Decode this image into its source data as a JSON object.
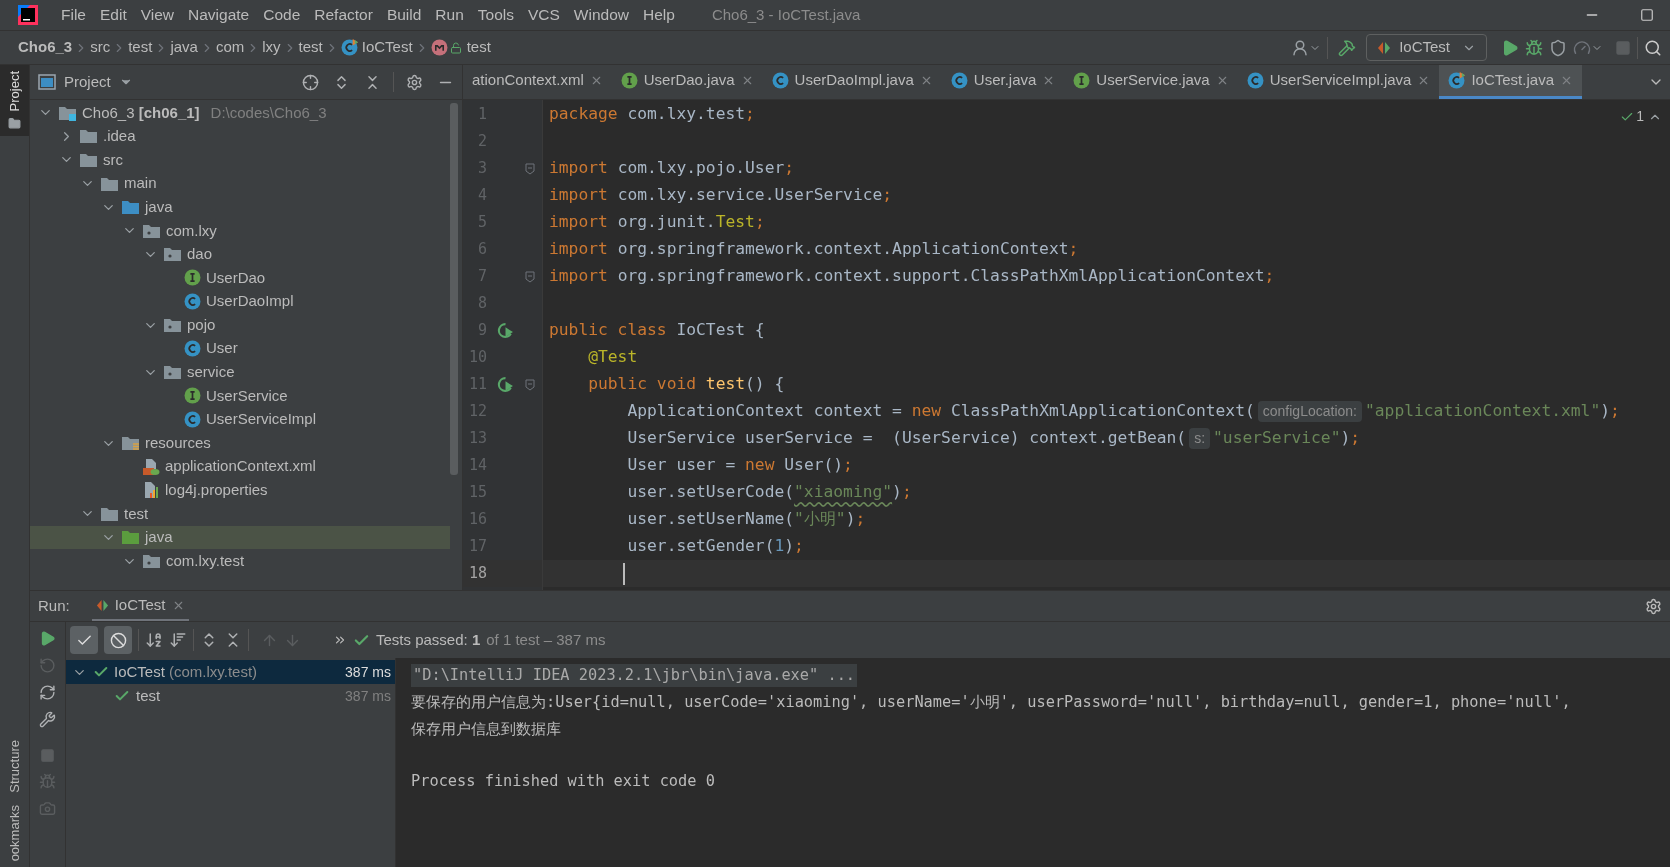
{
  "window": {
    "title": "Cho6_3 - IoCTest.java",
    "menu": [
      "File",
      "Edit",
      "View",
      "Navigate",
      "Code",
      "Refactor",
      "Build",
      "Run",
      "Tools",
      "VCS",
      "Window",
      "Help"
    ]
  },
  "breadcrumb": [
    {
      "label": "Cho6_3",
      "kind": "project"
    },
    {
      "label": "src",
      "kind": "folder"
    },
    {
      "label": "test",
      "kind": "folder"
    },
    {
      "label": "java",
      "kind": "folder"
    },
    {
      "label": "com",
      "kind": "folder"
    },
    {
      "label": "lxy",
      "kind": "folder"
    },
    {
      "label": "test",
      "kind": "folder"
    },
    {
      "label": "IoCTest",
      "kind": "test-class"
    },
    {
      "label": "test",
      "kind": "method"
    }
  ],
  "toolbar": {
    "run_config": "IoCTest"
  },
  "tool_strip": {
    "top": [
      {
        "label": "Project",
        "selected": true
      }
    ],
    "bottom": [
      {
        "label": "Structure",
        "selected": false
      },
      {
        "label": "ookmarks",
        "selected": false
      }
    ]
  },
  "project_panel": {
    "title": "Project",
    "tree": [
      {
        "label": "Cho6_3 **[ch06_1]**",
        "location": "D:\\codes\\Cho6_3",
        "kind": "module",
        "expanded": true,
        "selected": false,
        "children": [
          {
            "label": ".idea",
            "kind": "folder",
            "expanded": false,
            "selected": false
          },
          {
            "label": "src",
            "kind": "folder",
            "expanded": true,
            "selected": false,
            "children": [
              {
                "label": "main",
                "kind": "folder",
                "expanded": true,
                "selected": false,
                "children": [
                  {
                    "label": "java",
                    "kind": "source",
                    "expanded": true,
                    "selected": false,
                    "children": [
                      {
                        "label": "com.lxy",
                        "kind": "package",
                        "expanded": true,
                        "selected": false,
                        "children": [
                          {
                            "label": "dao",
                            "kind": "package",
                            "expanded": true,
                            "selected": false,
                            "children": [
                              {
                                "label": "UserDao",
                                "kind": "interface",
                                "selected": false
                              },
                              {
                                "label": "UserDaoImpl",
                                "kind": "class",
                                "selected": false
                              }
                            ]
                          },
                          {
                            "label": "pojo",
                            "kind": "package",
                            "expanded": true,
                            "selected": false,
                            "children": [
                              {
                                "label": "User",
                                "kind": "class",
                                "selected": false
                              }
                            ]
                          },
                          {
                            "label": "service",
                            "kind": "package",
                            "expanded": true,
                            "selected": false,
                            "children": [
                              {
                                "label": "UserService",
                                "kind": "interface",
                                "selected": false
                              },
                              {
                                "label": "UserServiceImpl",
                                "kind": "class",
                                "selected": false
                              }
                            ]
                          }
                        ]
                      }
                    ]
                  },
                  {
                    "label": "resources",
                    "kind": "resources",
                    "expanded": true,
                    "selected": false,
                    "children": [
                      {
                        "label": "applicationContext.xml",
                        "kind": "xml",
                        "selected": false
                      },
                      {
                        "label": "log4j.properties",
                        "kind": "properties",
                        "selected": false
                      }
                    ]
                  }
                ]
              },
              {
                "label": "test",
                "kind": "folder",
                "expanded": true,
                "selected": false,
                "children": [
                  {
                    "label": "java",
                    "kind": "test-source",
                    "expanded": true,
                    "selected": true,
                    "children": [
                      {
                        "label": "com.lxy.test",
                        "kind": "package",
                        "expanded": true,
                        "selected": false
                      }
                    ]
                  }
                ]
              }
            ]
          }
        ]
      }
    ]
  },
  "editor": {
    "tabs": [
      {
        "label": "ationContext.xml",
        "selected": false
      },
      {
        "label": "UserDao.java",
        "kind": "interface",
        "selected": false
      },
      {
        "label": "UserDaoImpl.java",
        "kind": "class",
        "selected": false
      },
      {
        "label": "User.java",
        "kind": "class",
        "selected": false
      },
      {
        "label": "UserService.java",
        "kind": "interface",
        "selected": false
      },
      {
        "label": "UserServiceImpl.java",
        "kind": "class",
        "selected": false
      },
      {
        "label": "IoCTest.java",
        "kind": "test-class",
        "selected": true
      }
    ],
    "inspection_count": "1",
    "lines": [
      {
        "number": "1",
        "tokens": [
          {
            "text": "package",
            "kind": "keyword"
          },
          {
            "text": " com.lxy.test",
            "kind": "plain"
          },
          {
            "text": ";",
            "kind": "keyword"
          }
        ]
      },
      {
        "number": "2"
      },
      {
        "number": "3",
        "fold": true,
        "tokens": [
          {
            "text": "import",
            "kind": "keyword"
          },
          {
            "text": " com.lxy.pojo.User",
            "kind": "plain"
          },
          {
            "text": ";",
            "kind": "keyword"
          }
        ]
      },
      {
        "number": "4",
        "tokens": [
          {
            "text": "import",
            "kind": "keyword"
          },
          {
            "text": " com.lxy.service.UserService",
            "kind": "plain"
          },
          {
            "text": ";",
            "kind": "keyword"
          }
        ]
      },
      {
        "number": "5",
        "tokens": [
          {
            "text": "import",
            "kind": "keyword"
          },
          {
            "text": " org.junit.",
            "kind": "plain"
          },
          {
            "text": "Test",
            "kind": "annotation"
          },
          {
            "text": ";",
            "kind": "keyword"
          }
        ]
      },
      {
        "number": "6",
        "tokens": [
          {
            "text": "import",
            "kind": "keyword"
          },
          {
            "text": " org.springframework.context.ApplicationContext",
            "kind": "plain"
          },
          {
            "text": ";",
            "kind": "keyword"
          }
        ]
      },
      {
        "number": "7",
        "fold": true,
        "tokens": [
          {
            "text": "import",
            "kind": "keyword"
          },
          {
            "text": " org.springframework.context.support.ClassPathXmlApplicationContext",
            "kind": "plain"
          },
          {
            "text": ";",
            "kind": "keyword"
          }
        ]
      },
      {
        "number": "8"
      },
      {
        "number": "9",
        "run_marker": true,
        "tokens": [
          {
            "text": "public class",
            "kind": "keyword"
          },
          {
            "text": " IoCTest {",
            "kind": "plain"
          }
        ]
      },
      {
        "number": "10",
        "tokens": [
          {
            "text": "    @Test",
            "kind": "annotation"
          }
        ]
      },
      {
        "number": "11",
        "run_marker": true,
        "fold": true,
        "tokens": [
          {
            "text": "    public void ",
            "kind": "keyword"
          },
          {
            "text": "test",
            "kind": "method"
          },
          {
            "text": "() {",
            "kind": "plain"
          }
        ]
      },
      {
        "number": "12",
        "tokens": [
          {
            "text": "        ApplicationContext context = ",
            "kind": "plain"
          },
          {
            "text": "new",
            "kind": "keyword"
          },
          {
            "text": " ClassPathXmlApplicationContext(",
            "kind": "plain"
          },
          {
            "text": "configLocation:",
            "kind": "hint"
          },
          {
            "text": "\"applicationContext.xml\"",
            "kind": "string"
          },
          {
            "text": ")",
            "kind": "plain"
          },
          {
            "text": ";",
            "kind": "keyword"
          }
        ]
      },
      {
        "number": "13",
        "tokens": [
          {
            "text": "        UserService userService =  (UserService) context.getBean(",
            "kind": "plain"
          },
          {
            "text": "s:",
            "kind": "hint"
          },
          {
            "text": "\"userService\"",
            "kind": "string"
          },
          {
            "text": ")",
            "kind": "plain"
          },
          {
            "text": ";",
            "kind": "keyword"
          }
        ]
      },
      {
        "number": "14",
        "tokens": [
          {
            "text": "        User user = ",
            "kind": "plain"
          },
          {
            "text": "new",
            "kind": "keyword"
          },
          {
            "text": " User()",
            "kind": "plain"
          },
          {
            "text": ";",
            "kind": "keyword"
          }
        ]
      },
      {
        "number": "15",
        "tokens": [
          {
            "text": "        user.setUserCode(",
            "kind": "plain"
          },
          {
            "text": "\"xiaoming\"",
            "kind": "typo"
          },
          {
            "text": ")",
            "kind": "plain"
          },
          {
            "text": ";",
            "kind": "keyword"
          }
        ]
      },
      {
        "number": "16",
        "tokens": [
          {
            "text": "        user.setUserName(",
            "kind": "plain"
          },
          {
            "text": "\"小明\"",
            "kind": "string"
          },
          {
            "text": ")",
            "kind": "plain"
          },
          {
            "text": ";",
            "kind": "keyword"
          }
        ]
      },
      {
        "number": "17",
        "tokens": [
          {
            "text": "        user.setGender(",
            "kind": "plain"
          },
          {
            "text": "1",
            "kind": "number"
          },
          {
            "text": ")",
            "kind": "plain"
          },
          {
            "text": ";",
            "kind": "keyword"
          }
        ]
      },
      {
        "number": "18",
        "current": true
      }
    ]
  },
  "run_panel": {
    "label": "Run:",
    "tab": "IoCTest",
    "filters": [
      {
        "kind": "passed",
        "selected": true
      },
      {
        "kind": "ignored",
        "selected": true
      }
    ],
    "status": "Tests passed: **1**",
    "status_detail": "of 1 test – 387 ms",
    "tests": [
      {
        "name": "IoCTest",
        "package": "(com.lxy.test)",
        "time": "387 ms",
        "passed": true,
        "selected": true,
        "expanded": true,
        "children": [
          {
            "name": "test",
            "time": "387 ms",
            "passed": true,
            "selected": false
          }
        ]
      }
    ],
    "console": [
      {
        "kind": "command",
        "text": "\"D:\\IntelliJ IDEA 2023.2.1\\jbr\\bin\\java.exe\" ..."
      },
      {
        "kind": "output",
        "text": "要保存的用户信息为:User{id=null, userCode='xiaoming', userName='小明', userPassword='null', birthday=null, gender=1, phone='null',"
      },
      {
        "kind": "output",
        "text": "保存用户信息到数据库"
      },
      {
        "kind": "exit",
        "text": "Process finished with exit code 0"
      }
    ]
  }
}
